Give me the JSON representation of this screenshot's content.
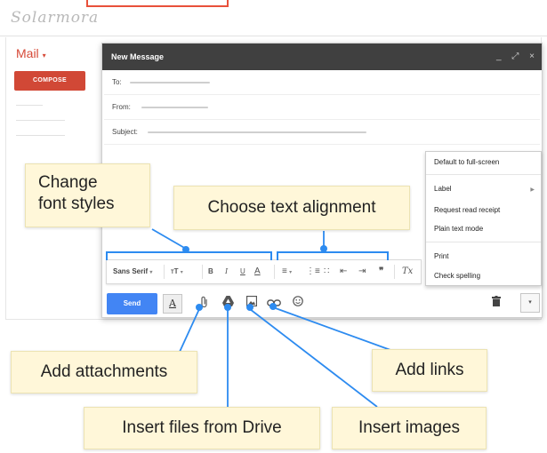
{
  "app": {
    "logo": "Solarmora",
    "mail_label": "Mail",
    "mail_caret": "▾",
    "compose_button": "COMPOSE"
  },
  "compose": {
    "title": "New Message",
    "controls": {
      "minimize": "_",
      "expand": "⤢",
      "close": "×"
    },
    "fields": {
      "to": "To:",
      "from": "From:",
      "subject": "Subject:"
    }
  },
  "more_menu": {
    "items": [
      {
        "label": "Default to full-screen"
      },
      {
        "label": "Label",
        "submenu": true
      },
      {
        "label": "Request read receipt"
      },
      {
        "label": "Plain text mode"
      },
      {
        "label": "Print"
      },
      {
        "label": "Check spelling"
      }
    ]
  },
  "format_toolbar": {
    "font": "Sans Serif",
    "font_caret": "▾",
    "size_icon": "size-icon",
    "size_caret": "▾",
    "bold": "B",
    "italic": "I",
    "underline": "U",
    "text_color": "A",
    "align_caret": "▾",
    "quote": "❞",
    "clear": "Tx"
  },
  "actions": {
    "send": "Send",
    "format_toggle": "A",
    "attach_icon": "paperclip-icon",
    "drive_icon": "drive-icon",
    "image_icon": "image-icon",
    "link_icon": "link-icon",
    "emoji_icon": "smiley-icon",
    "trash_icon": "trash-icon",
    "more_caret": "▾"
  },
  "callouts": {
    "font_styles_1": "Change",
    "font_styles_2": "font styles",
    "text_alignment": "Choose text alignment",
    "attachments": "Add attachments",
    "drive": "Insert files from Drive",
    "images": "Insert images",
    "links": "Add links"
  },
  "colors": {
    "accent_blue": "#2d8bf0",
    "compose_red": "#d14836",
    "send_blue": "#4285f4",
    "callout_bg": "#fff7d9",
    "header_dark": "#404040"
  }
}
